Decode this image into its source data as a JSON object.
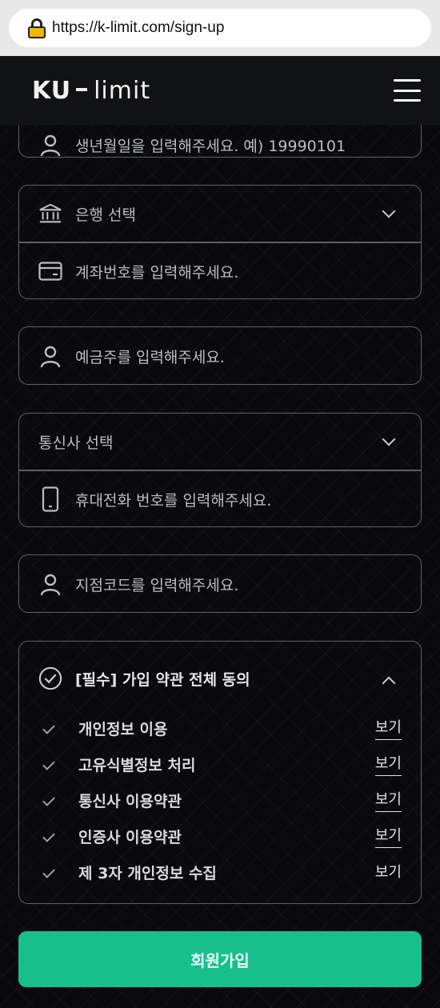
{
  "browser": {
    "url": "https://k-limit.com/sign-up"
  },
  "header": {
    "logo_main": "KU",
    "logo_tail": "limit"
  },
  "fields": {
    "birth_placeholder": "생년월일을 입력해주세요. 예) 19990101",
    "bank_select": "은행 선택",
    "account_placeholder": "계좌번호를 입력해주세요.",
    "holder_placeholder": "예금주를 입력해주세요.",
    "carrier_select": "통신사 선택",
    "phone_placeholder": "휴대전화 번호를 입력해주세요.",
    "branch_placeholder": "지점코드를 입력해주세요."
  },
  "terms": {
    "all_label": "[필수] 가입 약관 전체 동의",
    "items": [
      {
        "label": "개인정보 이용",
        "view": "보기"
      },
      {
        "label": "고유식별정보 처리",
        "view": "보기"
      },
      {
        "label": "통신사 이용약관",
        "view": "보기"
      },
      {
        "label": "인증사 이용약관",
        "view": "보기"
      },
      {
        "label": "제 3자 개인정보 수집",
        "view": "보기"
      }
    ]
  },
  "submit_label": "회원가입",
  "colors": {
    "accent": "#17c08a",
    "background": "#0a0a0c",
    "border": "#5a5f69"
  },
  "icons": [
    "lock-icon",
    "menu-icon",
    "person-icon",
    "bank-icon",
    "card-icon",
    "phone-icon",
    "check-circle-icon",
    "chevron-down-icon",
    "chevron-up-icon",
    "check-icon"
  ]
}
